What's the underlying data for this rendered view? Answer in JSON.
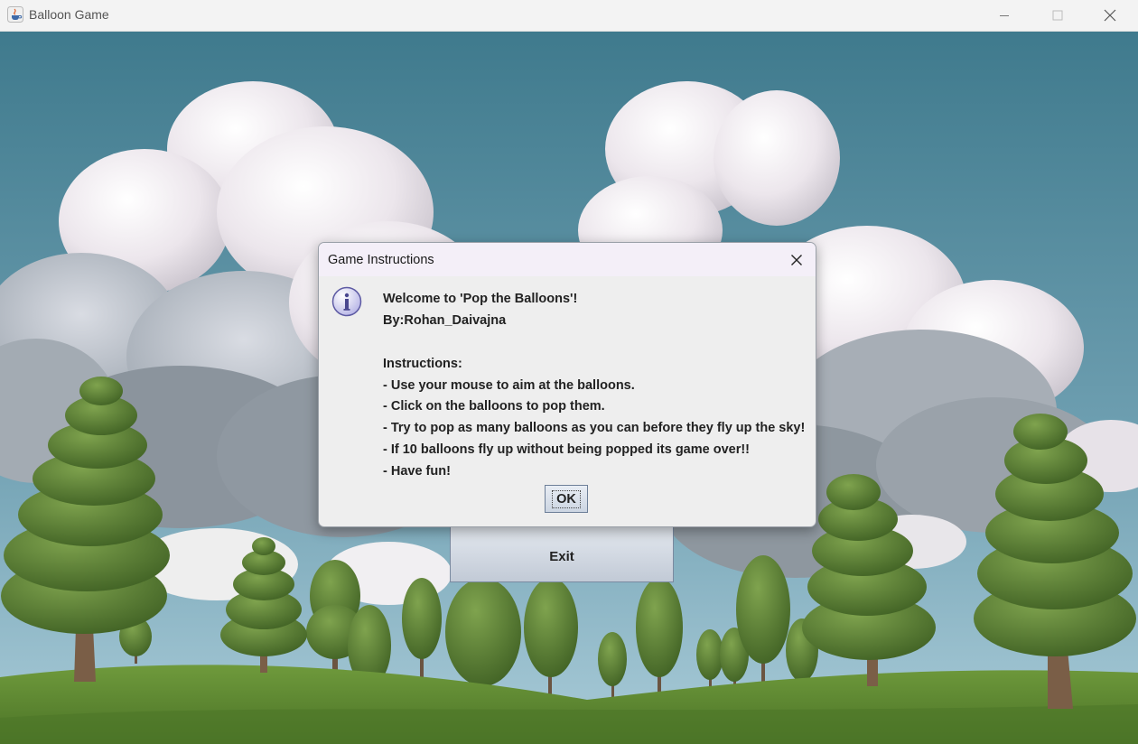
{
  "window": {
    "title": "Balloon Game"
  },
  "main": {
    "exit_label": "Exit"
  },
  "dialog": {
    "title": "Game Instructions",
    "icon": "info-icon",
    "lines": [
      "Welcome to 'Pop the Balloons'!",
      "By:Rohan_Daivajna",
      "",
      "Instructions:",
      "- Use your mouse to aim at the balloons.",
      "- Click on the balloons to pop them.",
      "- Try to pop as many balloons as you can before they fly up the sky!",
      "- If 10 balloons fly up without being popped its game over!!",
      "- Have fun!"
    ],
    "ok_label": "OK"
  },
  "colors": {
    "sky": "#4f8194",
    "grass": "#5f8a33",
    "dialog_bg": "#eeeeee",
    "button_accent": "#c8d1de"
  }
}
